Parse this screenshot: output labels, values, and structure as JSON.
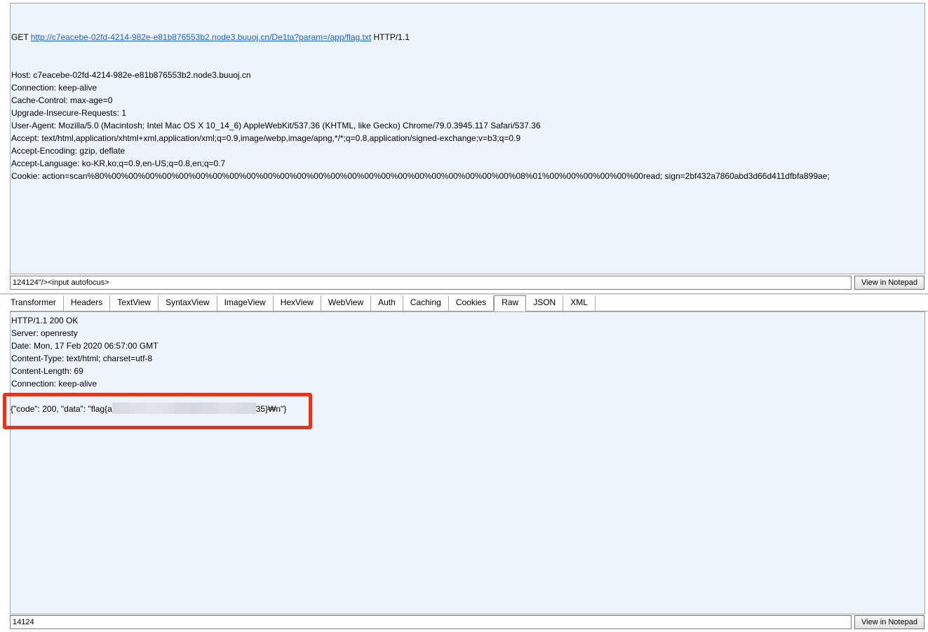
{
  "request": {
    "method": "GET",
    "url": "http://c7eacebe-02fd-4214-982e-e81b876553b2.node3.buuoj.cn/De1ta?param=/app/flag.txt",
    "protocol": "HTTP/1.1",
    "headers": [
      "Host: c7eacebe-02fd-4214-982e-e81b876553b2.node3.buuoj.cn",
      "Connection: keep-alive",
      "Cache-Control: max-age=0",
      "Upgrade-Insecure-Requests: 1",
      "User-Agent: Mozilla/5.0 (Macintosh; Intel Mac OS X 10_14_6) AppleWebKit/537.36 (KHTML, like Gecko) Chrome/79.0.3945.117 Safari/537.36",
      "Accept: text/html,application/xhtml+xml,application/xml;q=0.9,image/webp,image/apng,*/*;q=0.8,application/signed-exchange;v=b3;q=0.9",
      "Accept-Encoding: gzip, deflate",
      "Accept-Language: ko-KR,ko;q=0.9,en-US;q=0.8,en;q=0.7",
      "Cookie: action=scan%80%00%00%00%00%00%00%00%00%00%00%00%00%00%00%00%00%00%00%00%00%00%00%00%00%08%01%00%00%00%00%00%00read; sign=2bf432a7860abd3d66d411dfbfa899ae;"
    ],
    "bottom_input": "124124\"/><input autofocus>",
    "notepad_label": "View in Notepad"
  },
  "tabs": [
    {
      "label": "Transformer",
      "active": false
    },
    {
      "label": "Headers",
      "active": false
    },
    {
      "label": "TextView",
      "active": false
    },
    {
      "label": "SyntaxView",
      "active": false
    },
    {
      "label": "ImageView",
      "active": false
    },
    {
      "label": "HexView",
      "active": false
    },
    {
      "label": "WebView",
      "active": false
    },
    {
      "label": "Auth",
      "active": false
    },
    {
      "label": "Caching",
      "active": false
    },
    {
      "label": "Cookies",
      "active": false
    },
    {
      "label": "Raw",
      "active": true
    },
    {
      "label": "JSON",
      "active": false
    },
    {
      "label": "XML",
      "active": false
    }
  ],
  "response": {
    "headers": [
      "HTTP/1.1 200 OK",
      "Server: openresty",
      "Date: Mon, 17 Feb 2020 06:57:00 GMT",
      "Content-Type: text/html; charset=utf-8",
      "Content-Length: 69",
      "Connection: keep-alive"
    ],
    "body_prefix": "{\"code\": 200, \"data\": \"flag{a",
    "body_suffix": "35}₩n\"}",
    "bottom_input": "14124",
    "notepad_label": "View in Notepad"
  },
  "colors": {
    "pane_background": "#eef4fb",
    "link": "#1a5fd6",
    "highlight": "#e8331c"
  }
}
